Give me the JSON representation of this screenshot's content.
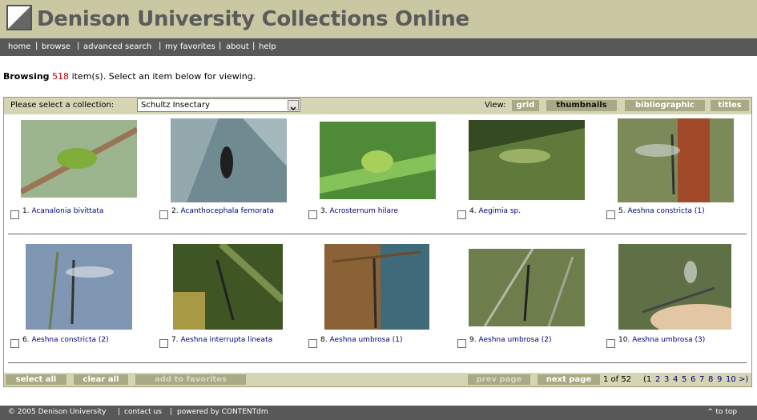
{
  "header": {
    "title": "Denison University Collections Online"
  },
  "nav": [
    "home",
    "browse",
    "advanced search",
    "my favorites",
    "about",
    "help"
  ],
  "browse": {
    "label": "Browsing",
    "count": "518",
    "suffix": "item(s). Select an item below for viewing."
  },
  "collection": {
    "label": "Please select a collection:",
    "selected": "Schultz Insectary"
  },
  "view": {
    "label": "View:",
    "options": [
      "grid",
      "thumbnails",
      "bibliographic",
      "titles"
    ],
    "active": "thumbnails"
  },
  "items": [
    {
      "num": "1.",
      "title": "Acanalonia bivittata"
    },
    {
      "num": "2.",
      "title": "Acanthocephala femorata"
    },
    {
      "num": "3.",
      "title": "Acrosternum hilare"
    },
    {
      "num": "4.",
      "title": "Aegimia sp."
    },
    {
      "num": "5.",
      "title": "Aeshna constricta (1)"
    },
    {
      "num": "6.",
      "title": "Aeshna constricta (2)"
    },
    {
      "num": "7.",
      "title": "Aeshna interrupta lineata"
    },
    {
      "num": "8.",
      "title": "Aeshna umbrosa (1)"
    },
    {
      "num": "9.",
      "title": "Aeshna umbrosa (2)"
    },
    {
      "num": "10.",
      "title": "Aeshna umbrosa (3)"
    }
  ],
  "actions": {
    "select_all": "select all",
    "clear_all": "clear all",
    "add_favorites": "add to favorites",
    "prev_page": "prev page",
    "next_page": "next page"
  },
  "pagination": {
    "of_text": "1 of 52",
    "open": "(1",
    "pages": [
      "2",
      "3",
      "4",
      "5",
      "6",
      "7",
      "8",
      "9",
      "10"
    ],
    "close": ">)"
  },
  "footer": {
    "copyright": "© 2005 Denison University",
    "contact": "contact us",
    "powered": "powered by CONTENTdm",
    "top": "^ to top"
  },
  "colors": {
    "banner": "#c9c8a2",
    "nav": "#585858",
    "bar": "#d6d5b3",
    "button": "#a9a985",
    "link": "#00007a",
    "count": "#cc0000"
  }
}
